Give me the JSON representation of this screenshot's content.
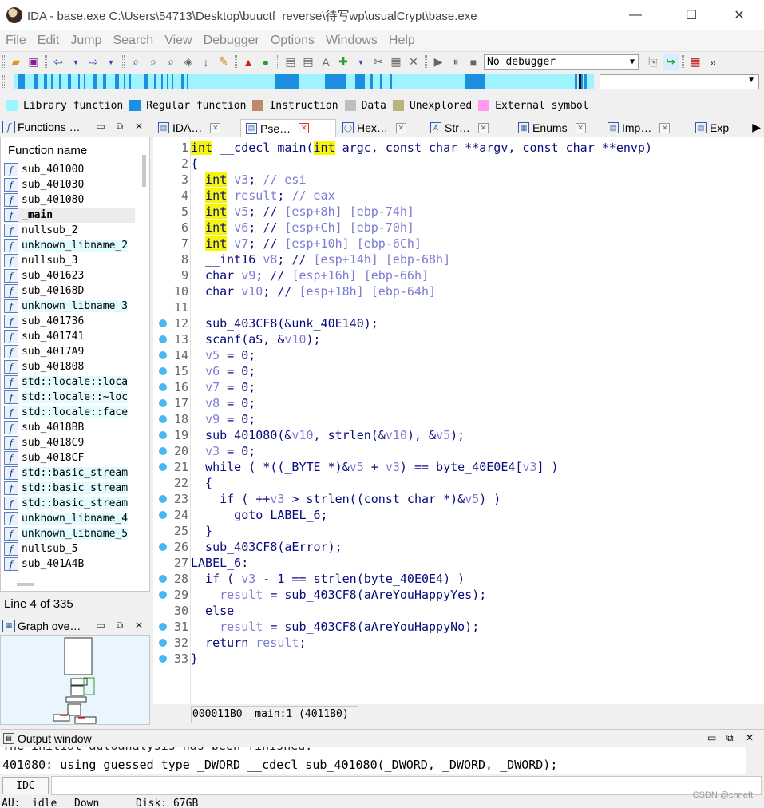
{
  "window": {
    "title": "IDA - base.exe C:\\Users\\54713\\Desktop\\buuctf_reverse\\待写wp\\usualCrypt\\base.exe",
    "minimize": "—",
    "maximize": "☐",
    "close": "✕"
  },
  "menu": [
    "File",
    "Edit",
    "Jump",
    "Search",
    "View",
    "Debugger",
    "Options",
    "Windows",
    "Help"
  ],
  "toolbar": {
    "debugger_select": "No debugger",
    "overflow": "»"
  },
  "legend": [
    {
      "label": "Library function",
      "color": "#9ff3ff"
    },
    {
      "label": "Regular function",
      "color": "#1c8fe0"
    },
    {
      "label": "Instruction",
      "color": "#c08a6a"
    },
    {
      "label": "Data",
      "color": "#bfbfbf"
    },
    {
      "label": "Unexplored",
      "color": "#b8b47a"
    },
    {
      "label": "External symbol",
      "color": "#ff9cf2"
    }
  ],
  "functions_panel": {
    "title": "Functions …",
    "header": "Function name",
    "items": [
      {
        "name": "sub_401000",
        "lib": false
      },
      {
        "name": "sub_401030",
        "lib": false
      },
      {
        "name": "sub_401080",
        "lib": false
      },
      {
        "name": "_main",
        "lib": false,
        "selected": true
      },
      {
        "name": "nullsub_2",
        "lib": false
      },
      {
        "name": "unknown_libname_2",
        "lib": true
      },
      {
        "name": "nullsub_3",
        "lib": false
      },
      {
        "name": "sub_401623",
        "lib": false
      },
      {
        "name": "sub_40168D",
        "lib": false
      },
      {
        "name": "unknown_libname_3",
        "lib": true
      },
      {
        "name": "sub_401736",
        "lib": false
      },
      {
        "name": "sub_401741",
        "lib": false
      },
      {
        "name": "sub_4017A9",
        "lib": false
      },
      {
        "name": "sub_401808",
        "lib": false
      },
      {
        "name": "std::locale::loca",
        "lib": true
      },
      {
        "name": "std::locale::~loc",
        "lib": true
      },
      {
        "name": "std::locale::face",
        "lib": true
      },
      {
        "name": "sub_4018BB",
        "lib": false
      },
      {
        "name": "sub_4018C9",
        "lib": false
      },
      {
        "name": "sub_4018CF",
        "lib": false
      },
      {
        "name": "std::basic_stream",
        "lib": true
      },
      {
        "name": "std::basic_stream",
        "lib": true
      },
      {
        "name": "std::basic_stream",
        "lib": true
      },
      {
        "name": "unknown_libname_4",
        "lib": true
      },
      {
        "name": "unknown_libname_5",
        "lib": true
      },
      {
        "name": "nullsub_5",
        "lib": false
      },
      {
        "name": "sub_401A4B",
        "lib": false
      }
    ],
    "status": "Line 4 of 335"
  },
  "graph_panel": {
    "title": "Graph ove…"
  },
  "tabs": [
    {
      "label": "IDA…",
      "icon": "▤",
      "active": false
    },
    {
      "label": "Pse…",
      "icon": "▤",
      "active": true
    },
    {
      "label": "Hex…",
      "icon": "◯",
      "active": false
    },
    {
      "label": "Str…",
      "icon": "A",
      "active": false
    },
    {
      "label": "Enums",
      "icon": "▦",
      "active": false
    },
    {
      "label": "Imp…",
      "icon": "▤",
      "active": false
    },
    {
      "label": "Exp",
      "icon": "▤",
      "active": false
    }
  ],
  "code_lines": [
    {
      "n": "1",
      "dot": false,
      "text": "int __cdecl main(int argc, const char **argv, const char **envp)"
    },
    {
      "n": "2",
      "dot": false,
      "text": "{"
    },
    {
      "n": "3",
      "dot": false,
      "text": "  int v3; // esi"
    },
    {
      "n": "4",
      "dot": false,
      "text": "  int result; // eax"
    },
    {
      "n": "5",
      "dot": false,
      "text": "  int v5; // [esp+8h] [ebp-74h]"
    },
    {
      "n": "6",
      "dot": false,
      "text": "  int v6; // [esp+Ch] [ebp-70h]"
    },
    {
      "n": "7",
      "dot": false,
      "text": "  int v7; // [esp+10h] [ebp-6Ch]"
    },
    {
      "n": "8",
      "dot": false,
      "text": "  __int16 v8; // [esp+14h] [ebp-68h]"
    },
    {
      "n": "9",
      "dot": false,
      "text": "  char v9; // [esp+16h] [ebp-66h]"
    },
    {
      "n": "10",
      "dot": false,
      "text": "  char v10; // [esp+18h] [ebp-64h]"
    },
    {
      "n": "11",
      "dot": false,
      "text": ""
    },
    {
      "n": "12",
      "dot": true,
      "text": "  sub_403CF8(&unk_40E140);"
    },
    {
      "n": "13",
      "dot": true,
      "text": "  scanf(aS, &v10);"
    },
    {
      "n": "14",
      "dot": true,
      "text": "  v5 = 0;"
    },
    {
      "n": "15",
      "dot": true,
      "text": "  v6 = 0;"
    },
    {
      "n": "16",
      "dot": true,
      "text": "  v7 = 0;"
    },
    {
      "n": "17",
      "dot": true,
      "text": "  v8 = 0;"
    },
    {
      "n": "18",
      "dot": true,
      "text": "  v9 = 0;"
    },
    {
      "n": "19",
      "dot": true,
      "text": "  sub_401080(&v10, strlen(&v10), &v5);"
    },
    {
      "n": "20",
      "dot": true,
      "text": "  v3 = 0;"
    },
    {
      "n": "21",
      "dot": true,
      "text": "  while ( *((_BYTE *)&v5 + v3) == byte_40E0E4[v3] )"
    },
    {
      "n": "22",
      "dot": false,
      "text": "  {"
    },
    {
      "n": "23",
      "dot": true,
      "text": "    if ( ++v3 > strlen((const char *)&v5) )"
    },
    {
      "n": "24",
      "dot": true,
      "text": "      goto LABEL_6;"
    },
    {
      "n": "25",
      "dot": false,
      "text": "  }"
    },
    {
      "n": "26",
      "dot": true,
      "text": "  sub_403CF8(aError);"
    },
    {
      "n": "27",
      "dot": false,
      "text": "LABEL_6:"
    },
    {
      "n": "28",
      "dot": true,
      "text": "  if ( v3 - 1 == strlen(byte_40E0E4) )"
    },
    {
      "n": "29",
      "dot": true,
      "text": "    result = sub_403CF8(aAreYouHappyYes);"
    },
    {
      "n": "30",
      "dot": false,
      "text": "  else"
    },
    {
      "n": "31",
      "dot": true,
      "text": "    result = sub_403CF8(aAreYouHappyNo);"
    },
    {
      "n": "32",
      "dot": true,
      "text": "  return result;"
    },
    {
      "n": "33",
      "dot": true,
      "text": "}"
    }
  ],
  "code_status": "000011B0 _main:1 (4011B0)",
  "output": {
    "title": "Output window",
    "line1": "The initial autoanalysis has been finished.",
    "line2": "401080: using guessed type _DWORD __cdecl sub_401080(_DWORD, _DWORD, _DWORD);"
  },
  "idc": {
    "button": "IDC"
  },
  "statusbar": {
    "au": "AU:",
    "state": "idle",
    "dir": "Down",
    "disk": "Disk: 67GB"
  },
  "watermark": "CSDN @chneft"
}
